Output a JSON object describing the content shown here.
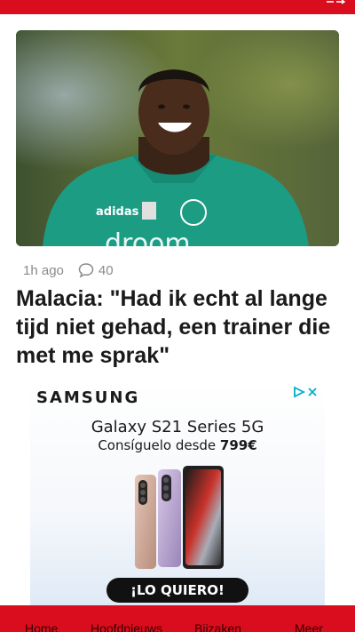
{
  "top_bar": {
    "color": "#d90d1d",
    "icon": "menu-arrow-icon"
  },
  "article": {
    "time": "1h ago",
    "comments_count": "40",
    "comment_icon": "speech-bubble-icon",
    "headline": "Malacia: \"Had ik echt al lange tijd niet gehad, een trainer die met me sprak\""
  },
  "ad": {
    "brand": "SAMSUNG",
    "product": "Galaxy S21 Series 5G",
    "offer_prefix": "Consíguelo desde ",
    "offer_price": "799€",
    "cta": "¡LO QUIERO!",
    "adchoices_icon": "adchoices-icon"
  },
  "bottom_nav": {
    "color": "#d90d1d",
    "items": [
      "Home",
      "Hoofdnieuws",
      "Bijzaken",
      "Meer"
    ]
  }
}
